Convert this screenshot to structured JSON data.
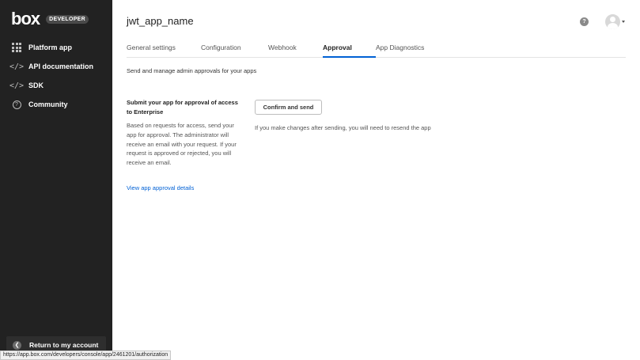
{
  "sidebar": {
    "logo_text": "box",
    "logo_badge": "DEVELOPER",
    "items": [
      {
        "label": "Platform app",
        "icon": "grid-icon"
      },
      {
        "label": "API documentation",
        "icon": "code-icon"
      },
      {
        "label": "SDK",
        "icon": "code-icon"
      },
      {
        "label": "Community",
        "icon": "question-circle-icon"
      }
    ],
    "return_label": "Return to my account"
  },
  "header": {
    "app_title": "jwt_app_name",
    "help_icon": "?"
  },
  "tabs": [
    {
      "label": "General settings",
      "active": false
    },
    {
      "label": "Configuration",
      "active": false
    },
    {
      "label": "Webhook",
      "active": false
    },
    {
      "label": "Approval",
      "active": true
    },
    {
      "label": "App Diagnostics",
      "active": false
    }
  ],
  "main": {
    "intro": "Send and manage admin approvals for your apps",
    "section_title": "Submit your app for approval of access to Enterprise",
    "section_desc": "Based on requests for access, send your app for approval. The administrator will receive an email with your request. If your request is approved or rejected, you will receive an email.",
    "details_link": "View app approval details",
    "confirm_button": "Confirm and send",
    "resend_note": "If you make changes after sending, you will need to resend the app"
  },
  "status_bar": {
    "url": "https://app.box.com/developers/console/app/2461201/authorization"
  },
  "colors": {
    "sidebar_bg": "#222222",
    "accent": "#0061d5"
  }
}
